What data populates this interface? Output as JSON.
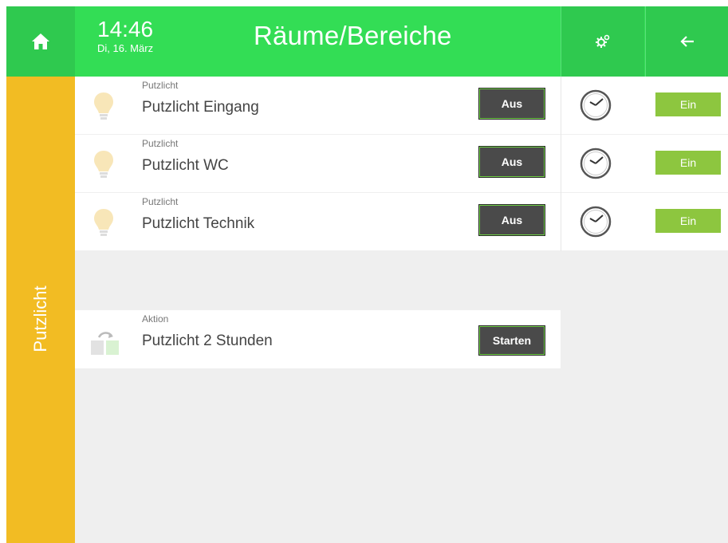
{
  "header": {
    "time": "14:46",
    "date": "Di, 16. März",
    "title": "Räume/Bereiche"
  },
  "side_tab": {
    "label": "Putzlicht"
  },
  "rows": [
    {
      "category": "Putzlicht",
      "name": "Putzlicht Eingang",
      "button": "Aus",
      "schedule_button": "Ein"
    },
    {
      "category": "Putzlicht",
      "name": "Putzlicht WC",
      "button": "Aus",
      "schedule_button": "Ein"
    },
    {
      "category": "Putzlicht",
      "name": "Putzlicht Technik",
      "button": "Aus",
      "schedule_button": "Ein"
    }
  ],
  "action": {
    "category": "Aktion",
    "name": "Putzlicht 2 Stunden",
    "button": "Starten"
  },
  "icons": {
    "home": "home-icon",
    "settings": "settings-gear-icon",
    "back": "arrow-left-icon",
    "light": "lightbulb-icon",
    "clock": "clock-icon",
    "action": "scene-action-icon"
  },
  "colors": {
    "header": "#33dd55",
    "side_tab": "#f2bc23",
    "ein_button": "#8dc63f",
    "dark_button": "#4a4a4a"
  }
}
